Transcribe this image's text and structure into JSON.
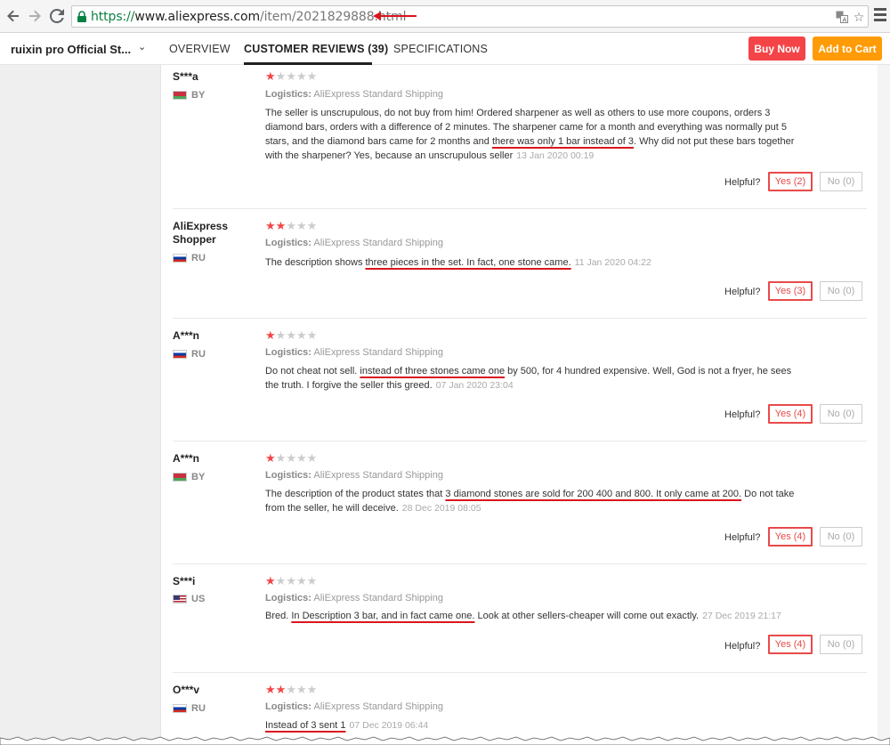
{
  "browser": {
    "url_proto": "https://",
    "url_host": "www.aliexpress.com",
    "url_path": "/item/2021829888.html"
  },
  "store": {
    "name": "ruixin pro Official St...",
    "tabs": [
      "OVERVIEW",
      "CUSTOMER REVIEWS (39)",
      "SPECIFICATIONS"
    ],
    "active_tab": 1,
    "buy_now": "Buy Now",
    "add_to_cart": "Add to Cart",
    "buy_color": "#f44447",
    "cart_color": "#ff9b05"
  },
  "reviews": [
    {
      "user": "S***a",
      "country": "BY",
      "stars": 1,
      "logistics_label": "Logistics:",
      "logistics": "AliExpress Standard Shipping",
      "text_before": "The seller is unscrupulous, do not buy from him! Ordered sharpener as well as others to use more coupons, orders 3 diamond bars, orders with a difference of 2 minutes. The sharpener came for a month and everything was normally put 5 stars, and the diamond bars came for 2 months and ",
      "text_marked": "there was only 1 bar instead of 3",
      "text_after": ". Why did not put these bars together with the sharpener? Yes, because an unscrupulous seller",
      "date": "13 Jan 2020 00:19",
      "helpful": "Helpful?",
      "yes": "Yes (2)",
      "no": "No (0)"
    },
    {
      "user": "AliExpress Shopper",
      "country": "RU",
      "stars": 2,
      "logistics_label": "Logistics:",
      "logistics": "AliExpress Standard Shipping",
      "text_before": "The description shows ",
      "text_marked": "three pieces in the set. In fact, one stone came.",
      "text_after": "",
      "date": "11 Jan 2020 04:22",
      "helpful": "Helpful?",
      "yes": "Yes (3)",
      "no": "No (0)"
    },
    {
      "user": "A***n",
      "country": "RU",
      "stars": 1,
      "logistics_label": "Logistics:",
      "logistics": "AliExpress Standard Shipping",
      "text_before": "Do not cheat not sell. ",
      "text_marked": "instead of three stones came one",
      "text_after": " by 500, for 4 hundred expensive. Well, God is not a fryer, he sees the truth. I forgive the seller this greed.",
      "date": "07 Jan 2020 23:04",
      "helpful": "Helpful?",
      "yes": "Yes (4)",
      "no": "No (0)"
    },
    {
      "user": "A***n",
      "country": "BY",
      "stars": 1,
      "logistics_label": "Logistics:",
      "logistics": "AliExpress Standard Shipping",
      "text_before": "The description of the product states that ",
      "text_marked": "3 diamond stones are sold for 200 400 and 800. It only came at 200.",
      "text_after": " Do not take from the seller, he will deceive.",
      "date": "28 Dec 2019 08:05",
      "helpful": "Helpful?",
      "yes": "Yes (4)",
      "no": "No (0)"
    },
    {
      "user": "S***i",
      "country": "US",
      "stars": 1,
      "logistics_label": "Logistics:",
      "logistics": "AliExpress Standard Shipping",
      "text_before": "Bred. ",
      "text_marked": "In Description 3 bar, and in fact came one.",
      "text_after": " Look at other sellers-cheaper will come out exactly.",
      "date": "27 Dec 2019 21:17",
      "helpful": "Helpful?",
      "yes": "Yes (4)",
      "no": "No (0)"
    },
    {
      "user": "O***v",
      "country": "RU",
      "stars": 2,
      "logistics_label": "Logistics:",
      "logistics": "AliExpress Standard Shipping",
      "text_before": "",
      "text_marked": "Instead of 3 sent 1",
      "text_after": "",
      "date": "07 Dec 2019 06:44"
    }
  ]
}
